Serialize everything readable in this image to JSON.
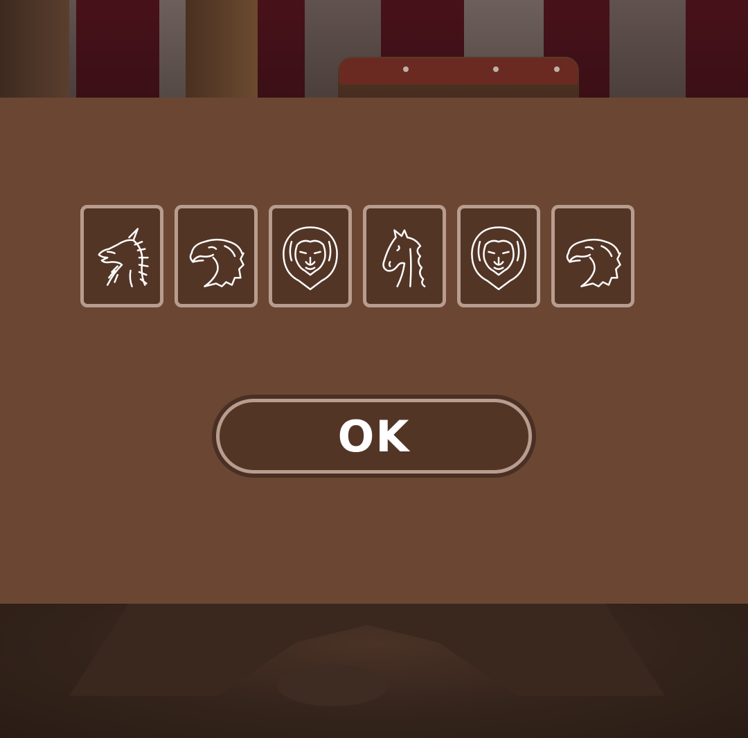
{
  "cards": [
    {
      "animal": "dragon",
      "icon": "dragon-icon"
    },
    {
      "animal": "eagle",
      "icon": "eagle-icon"
    },
    {
      "animal": "lion",
      "icon": "lion-icon"
    },
    {
      "animal": "horse",
      "icon": "horse-icon"
    },
    {
      "animal": "lion",
      "icon": "lion-icon"
    },
    {
      "animal": "eagle",
      "icon": "eagle-icon"
    }
  ],
  "ok_button": {
    "label": "OK"
  },
  "colors": {
    "panel": "#6b4733",
    "card_fill": "#533526",
    "card_border": "#b89d8f",
    "text": "#ffffff"
  }
}
